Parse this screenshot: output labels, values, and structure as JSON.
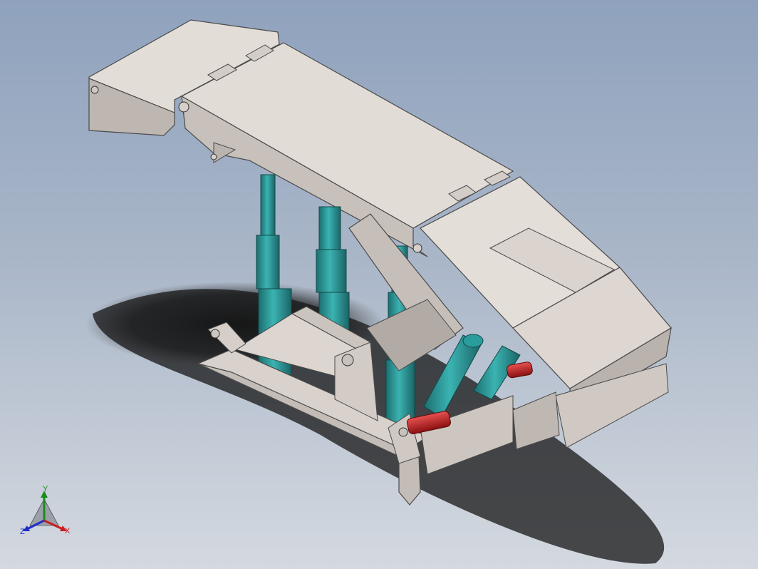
{
  "viewport": {
    "background_top": "#8fa2bd",
    "background_bottom": "#d4d9e0",
    "model_color": "#d9d2cc",
    "cylinder_color": "#2a9c9c",
    "rod_color": "#cc2020"
  },
  "triad": {
    "y_label": "Y",
    "x_label": "X",
    "z_label": "Z",
    "y_color": "#1c8a1c",
    "x_color": "#c81e1e",
    "z_color": "#1e2fc8"
  }
}
